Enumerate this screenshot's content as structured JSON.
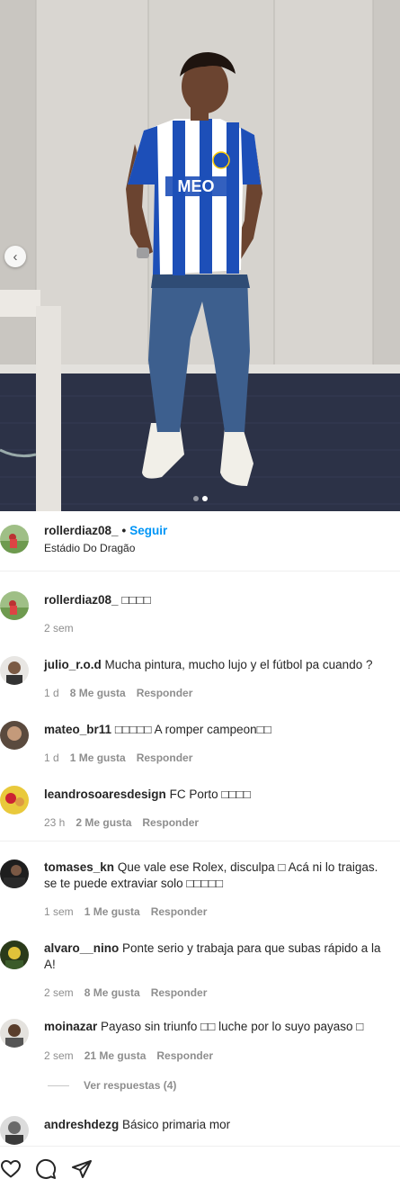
{
  "post": {
    "username": "rollerdiaz08_",
    "separator": "•",
    "follow_label": "Seguir",
    "location": "Estádio Do Dragão",
    "carousel_prev_glyph": "‹",
    "carousel": {
      "count": 2,
      "active": 2
    }
  },
  "comments": [
    {
      "username": "rollerdiaz08_",
      "text": "□□□□",
      "time": "2 sem",
      "likes": "",
      "reply": ""
    },
    {
      "username": "julio_r.o.d",
      "text": "Mucha pintura, mucho lujo y el fútbol pa cuando ?",
      "time": "1 d",
      "likes": "8 Me gusta",
      "reply": "Responder"
    },
    {
      "username": "mateo_br11",
      "text": "□□□□□ A romper campeon□□",
      "time": "1 d",
      "likes": "1 Me gusta",
      "reply": "Responder"
    },
    {
      "username": "leandrosoaresdesign",
      "text": "FC Porto □□□□",
      "time": "23 h",
      "likes": "2 Me gusta",
      "reply": "Responder"
    },
    {
      "username": "tomases_kn",
      "text": "Que vale ese Rolex, disculpa □ Acá ni lo traigas. se te puede extraviar solo □□□□□",
      "time": "1 sem",
      "likes": "1 Me gusta",
      "reply": "Responder"
    },
    {
      "username": "alvaro__nino",
      "text": "Ponte serio y trabaja para que subas rápido a la A!",
      "time": "2 sem",
      "likes": "8 Me gusta",
      "reply": "Responder"
    },
    {
      "username": "moinazar",
      "text": "Payaso sin triunfo □□ luche por lo suyo payaso □",
      "time": "2 sem",
      "likes": "21 Me gusta",
      "reply": "Responder"
    },
    {
      "username": "andreshdezg",
      "text": "Básico primaria mor",
      "time": "",
      "likes": "",
      "reply": ""
    }
  ],
  "view_replies": "Ver respuestas (4)",
  "icons": {
    "like": "heart-icon",
    "comment": "comment-icon",
    "share": "share-icon",
    "prev": "chevron-left-icon"
  },
  "colors": {
    "link": "#0095f6",
    "text": "#262626",
    "muted": "#8e8e8e",
    "jersey_blue": "#1d4fb8"
  }
}
